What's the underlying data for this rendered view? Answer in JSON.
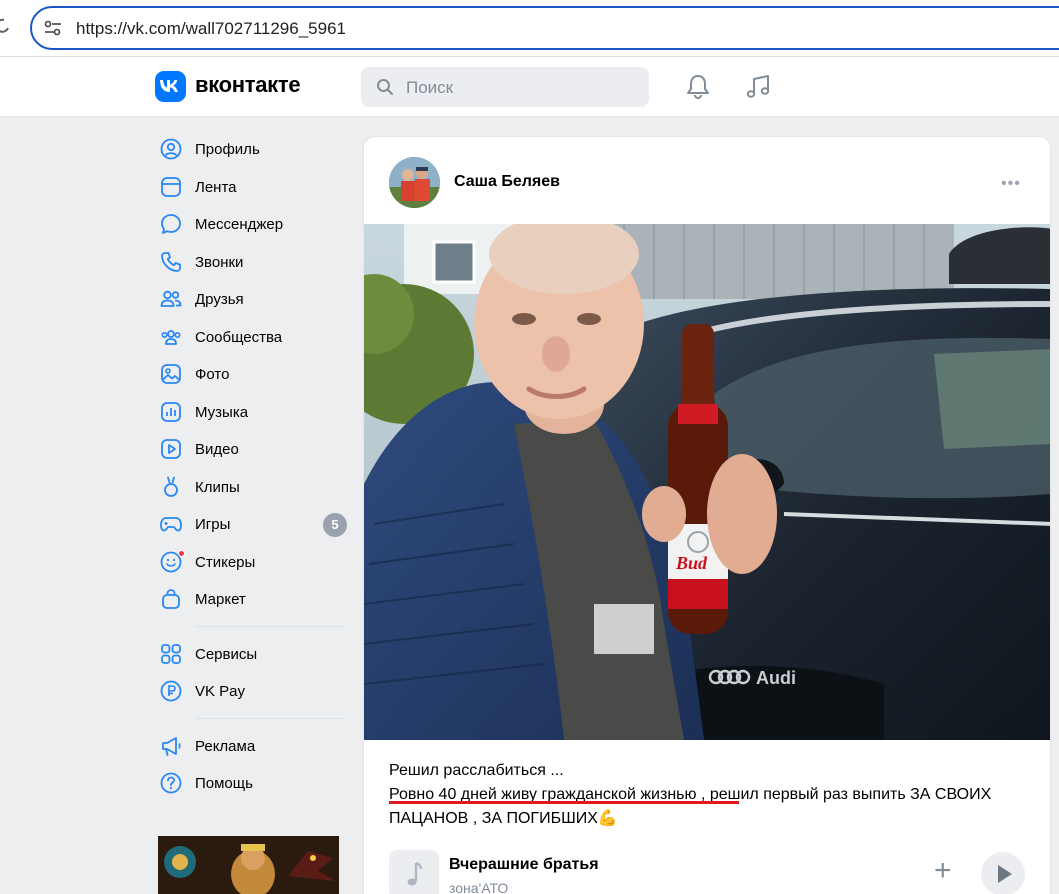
{
  "browser": {
    "url": "https://vk.com/wall702711296_5961"
  },
  "header": {
    "brand": "вконтакте",
    "search_placeholder": "Поиск",
    "accent": "#0077ff"
  },
  "nav": {
    "items": [
      {
        "label": "Профиль",
        "icon": "profile-icon"
      },
      {
        "label": "Лента",
        "icon": "feed-icon"
      },
      {
        "label": "Мессенджер",
        "icon": "messenger-icon"
      },
      {
        "label": "Звонки",
        "icon": "phone-icon"
      },
      {
        "label": "Друзья",
        "icon": "friends-icon"
      },
      {
        "label": "Сообщества",
        "icon": "communities-icon"
      },
      {
        "label": "Фото",
        "icon": "photo-icon"
      },
      {
        "label": "Музыка",
        "icon": "music-icon"
      },
      {
        "label": "Видео",
        "icon": "video-icon"
      },
      {
        "label": "Клипы",
        "icon": "clips-icon"
      },
      {
        "label": "Игры",
        "icon": "games-icon",
        "badge": "5"
      },
      {
        "label": "Стикеры",
        "icon": "stickers-icon"
      },
      {
        "label": "Маркет",
        "icon": "market-icon"
      }
    ],
    "items2": [
      {
        "label": "Сервисы",
        "icon": "services-icon"
      },
      {
        "label": "VK Pay",
        "icon": "vkpay-icon"
      }
    ],
    "items3": [
      {
        "label": "Реклама",
        "icon": "ads-icon"
      },
      {
        "label": "Помощь",
        "icon": "help-icon"
      }
    ]
  },
  "post": {
    "author": "Саша Беляев",
    "text_line1": "Решил расслабиться ...",
    "text_highlight": "Ровно 40 дней живу гражданской жизнью",
    "text_rest": " , решил первый раз выпить ЗА СВОИХ ПАЦАНОВ , ЗА ПОГИБШИХ💪",
    "audio": {
      "title": "Вчерашние братья",
      "artist": "зона'АТО"
    }
  }
}
